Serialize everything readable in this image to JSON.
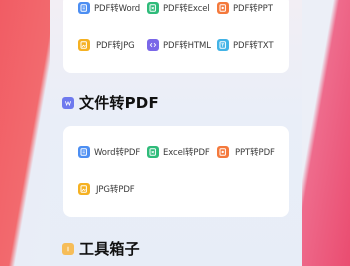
{
  "top_card": {
    "items": [
      {
        "label": "PDF转Word",
        "icon": "word-doc-icon",
        "color": "#4c8ef2"
      },
      {
        "label": "PDF转Excel",
        "icon": "excel-doc-icon",
        "color": "#2fbb7a"
      },
      {
        "label": "PDF转PPT",
        "icon": "ppt-doc-icon",
        "color": "#f4793c"
      },
      {
        "label": "PDF转JPG",
        "icon": "image-doc-icon",
        "color": "#f5b122"
      },
      {
        "label": "PDF转HTML",
        "icon": "html-doc-icon",
        "color": "#7a67e8"
      },
      {
        "label": "PDF转TXT",
        "icon": "txt-doc-icon",
        "color": "#42b3e6"
      }
    ]
  },
  "file_to_pdf": {
    "title": "文件转PDF",
    "icon": "word-badge-icon",
    "items": [
      {
        "label": "Word转PDF",
        "icon": "word-doc-icon",
        "color": "#4c8ef2"
      },
      {
        "label": "Excel转PDF",
        "icon": "excel-doc-icon",
        "color": "#2fbb7a"
      },
      {
        "label": "PPT转PDF",
        "icon": "ppt-doc-icon",
        "color": "#f4793c"
      },
      {
        "label": "JPG转PDF",
        "icon": "image-doc-icon",
        "color": "#f5b122"
      }
    ]
  },
  "toolbox": {
    "title": "工具箱子",
    "icon": "toolbox-icon"
  }
}
